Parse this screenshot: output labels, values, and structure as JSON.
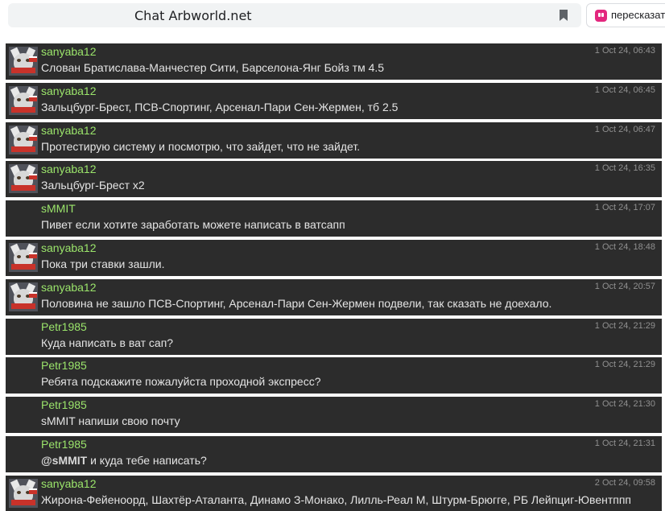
{
  "browser": {
    "page_title": "Chat Arbworld.net",
    "extension_label": "пересказат",
    "bookmark_icon": "bookmark-icon",
    "extension_icon": "quote-icon",
    "extension_color": "#e3277e"
  },
  "chat": {
    "username_color": "#9be56b",
    "messages": [
      {
        "user": "sanyaba12",
        "time": "1 Oct 24, 06:43",
        "text": "Слован Братислава-Манчестер Сити, Барселона-Янг Бойз тм 4.5",
        "avatar": true
      },
      {
        "user": "sanyaba12",
        "time": "1 Oct 24, 06:45",
        "text": "Зальцбург-Брест, ПСВ-Спортинг, Арсенал-Пари Сен-Жермен, тб 2.5",
        "avatar": true
      },
      {
        "user": "sanyaba12",
        "time": "1 Oct 24, 06:47",
        "text": "Протестирую систему и посмотрю, что зайдет, что не зайдет.",
        "avatar": true
      },
      {
        "user": "sanyaba12",
        "time": "1 Oct 24, 16:35",
        "text": "Зальцбург-Брест х2",
        "avatar": true
      },
      {
        "user": "sMMIT",
        "time": "1 Oct 24, 17:07",
        "text": "Пивет если хотите заработать можете написать в ватсапп",
        "avatar": false
      },
      {
        "user": "sanyaba12",
        "time": "1 Oct 24, 18:48",
        "text": "Пока три ставки зашли.",
        "avatar": true
      },
      {
        "user": "sanyaba12",
        "time": "1 Oct 24, 20:57",
        "text": "Половина не зашло ПСВ-Спортинг, Арсенал-Пари Сен-Жермен подвели, так сказать не доехало.",
        "avatar": true
      },
      {
        "user": "Petr1985",
        "time": "1 Oct 24, 21:29",
        "text": "Куда написать в ват сап?",
        "avatar": false
      },
      {
        "user": "Petr1985",
        "time": "1 Oct 24, 21:29",
        "text": "Ребята подскажите пожалуйста проходной экспресс?",
        "avatar": false
      },
      {
        "user": "Petr1985",
        "time": "1 Oct 24, 21:30",
        "text": "sMMIT напиши свою почту",
        "avatar": false
      },
      {
        "user": "Petr1985",
        "time": "1 Oct 24, 21:31",
        "mention": "@sMMIT",
        "text": " и куда тебе написать?",
        "avatar": false
      },
      {
        "user": "sanyaba12",
        "time": "2 Oct 24, 09:58",
        "text": "Жирона-Фейеноорд, Шахтёр-Аталанта, Динамо З-Монако, Лилль-Реал М, Штурм-Брюгге, РБ Лейпциг-Ювентппп",
        "avatar": true
      }
    ]
  }
}
